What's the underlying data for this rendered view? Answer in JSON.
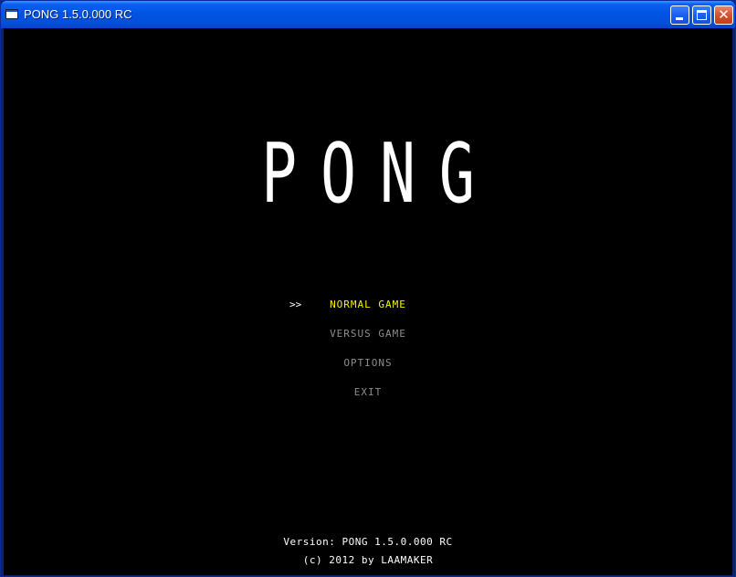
{
  "window": {
    "title": "PONG 1.5.0.000 RC",
    "icon": "app-window-icon"
  },
  "game": {
    "logo": "PONG",
    "cursor": ">>",
    "menu": [
      {
        "label": "NORMAL GAME",
        "selected": true
      },
      {
        "label": "VERSUS GAME",
        "selected": false
      },
      {
        "label": "OPTIONS",
        "selected": false
      },
      {
        "label": "EXIT",
        "selected": false
      }
    ],
    "footer": {
      "version": "Version: PONG 1.5.0.000 RC",
      "copyright": "(c) 2012 by LAAMAKER"
    }
  },
  "colors": {
    "background": "#000000",
    "selected": "#f4f400",
    "unselected": "#8c8c8c",
    "text": "#ffffff"
  }
}
